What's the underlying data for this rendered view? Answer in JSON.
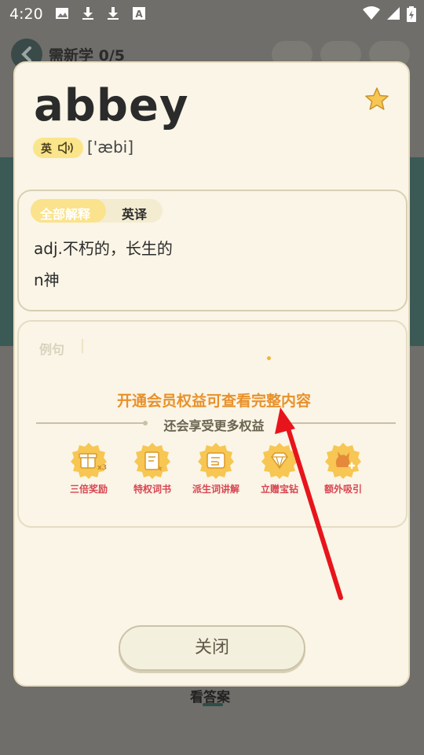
{
  "status_bar": {
    "time": "4:20"
  },
  "background": {
    "title": "需新学 0/5",
    "bottom_label": "看答案"
  },
  "word_card": {
    "word": "abbey",
    "accent_label": "英",
    "phonetic": "['æbi]",
    "tabs": {
      "all": "全部解释",
      "english": "英译"
    },
    "definitions": [
      "adj.不朽的，长生的",
      "n神"
    ],
    "example_label": "例句"
  },
  "vip": {
    "title": "开通会员权益可查看完整内容",
    "subtitle": "还会享受更多权益",
    "benefits": [
      {
        "label": "三倍奖励",
        "icon": "gift-x3-icon"
      },
      {
        "label": "特权词书",
        "icon": "book-icon"
      },
      {
        "label": "派生词讲解",
        "icon": "word-explain-icon"
      },
      {
        "label": "立赠宝钻",
        "icon": "diamond-icon"
      },
      {
        "label": "额外吸引",
        "icon": "pet-icon"
      }
    ]
  },
  "close_button": "关闭",
  "colors": {
    "accent_orange": "#e8912b",
    "badge_yellow": "#f7c653",
    "benefit_red": "#d84552",
    "arrow_red": "#e8141c"
  }
}
